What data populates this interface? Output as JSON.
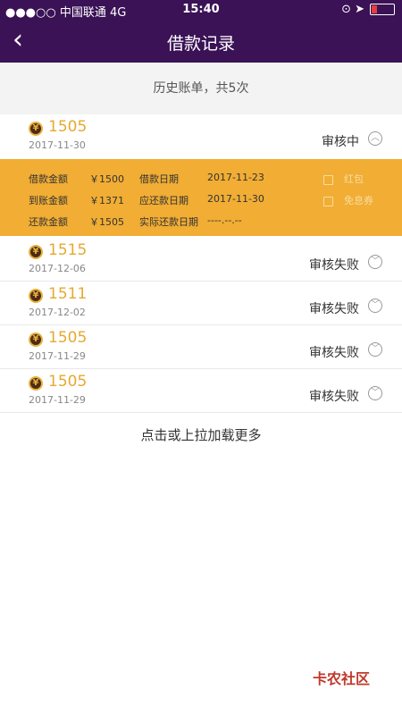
{
  "status_bar": {
    "carrier": "●●●○○ 中国联通  4G",
    "time": "15:40",
    "right_text": "⊙ ➤"
  },
  "nav": {
    "title": "借款记录",
    "back_glyph": "‹"
  },
  "summary": {
    "text": "历史账单，共5次"
  },
  "coin_glyph": "¥",
  "loans": [
    {
      "amount": "1505",
      "date": "2017-11-30",
      "status": "审核中",
      "expanded": true
    },
    {
      "amount": "1515",
      "date": "2017-12-06",
      "status": "审核失败",
      "expanded": false
    },
    {
      "amount": "1511",
      "date": "2017-12-02",
      "status": "审核失败",
      "expanded": false
    },
    {
      "amount": "1505",
      "date": "2017-11-29",
      "status": "审核失败",
      "expanded": false
    },
    {
      "amount": "1505",
      "date": "2017-11-29",
      "status": "审核失败",
      "expanded": false
    }
  ],
  "detail": {
    "borrow_amount_label": "借款金额",
    "borrow_amount_value": "￥1500",
    "arrival_amount_label": "到账金额",
    "arrival_amount_value": "￥1371",
    "repay_amount_label": "还款金额",
    "repay_amount_value": "￥1505",
    "borrow_date_label": "借款日期",
    "borrow_date_value": "2017-11-23",
    "due_date_label": "应还款日期",
    "due_date_value": "2017-11-30",
    "actual_repay_label": "实际还款日期",
    "actual_repay_value": "----.--.--",
    "red_packet_label": "红包",
    "coupon_label": "免息券"
  },
  "load_more": "点击或上拉加载更多",
  "watermark": "卡农社区",
  "colors": {
    "header": "#3a1255",
    "accent": "#f1ad34",
    "amount": "#e6a930"
  }
}
